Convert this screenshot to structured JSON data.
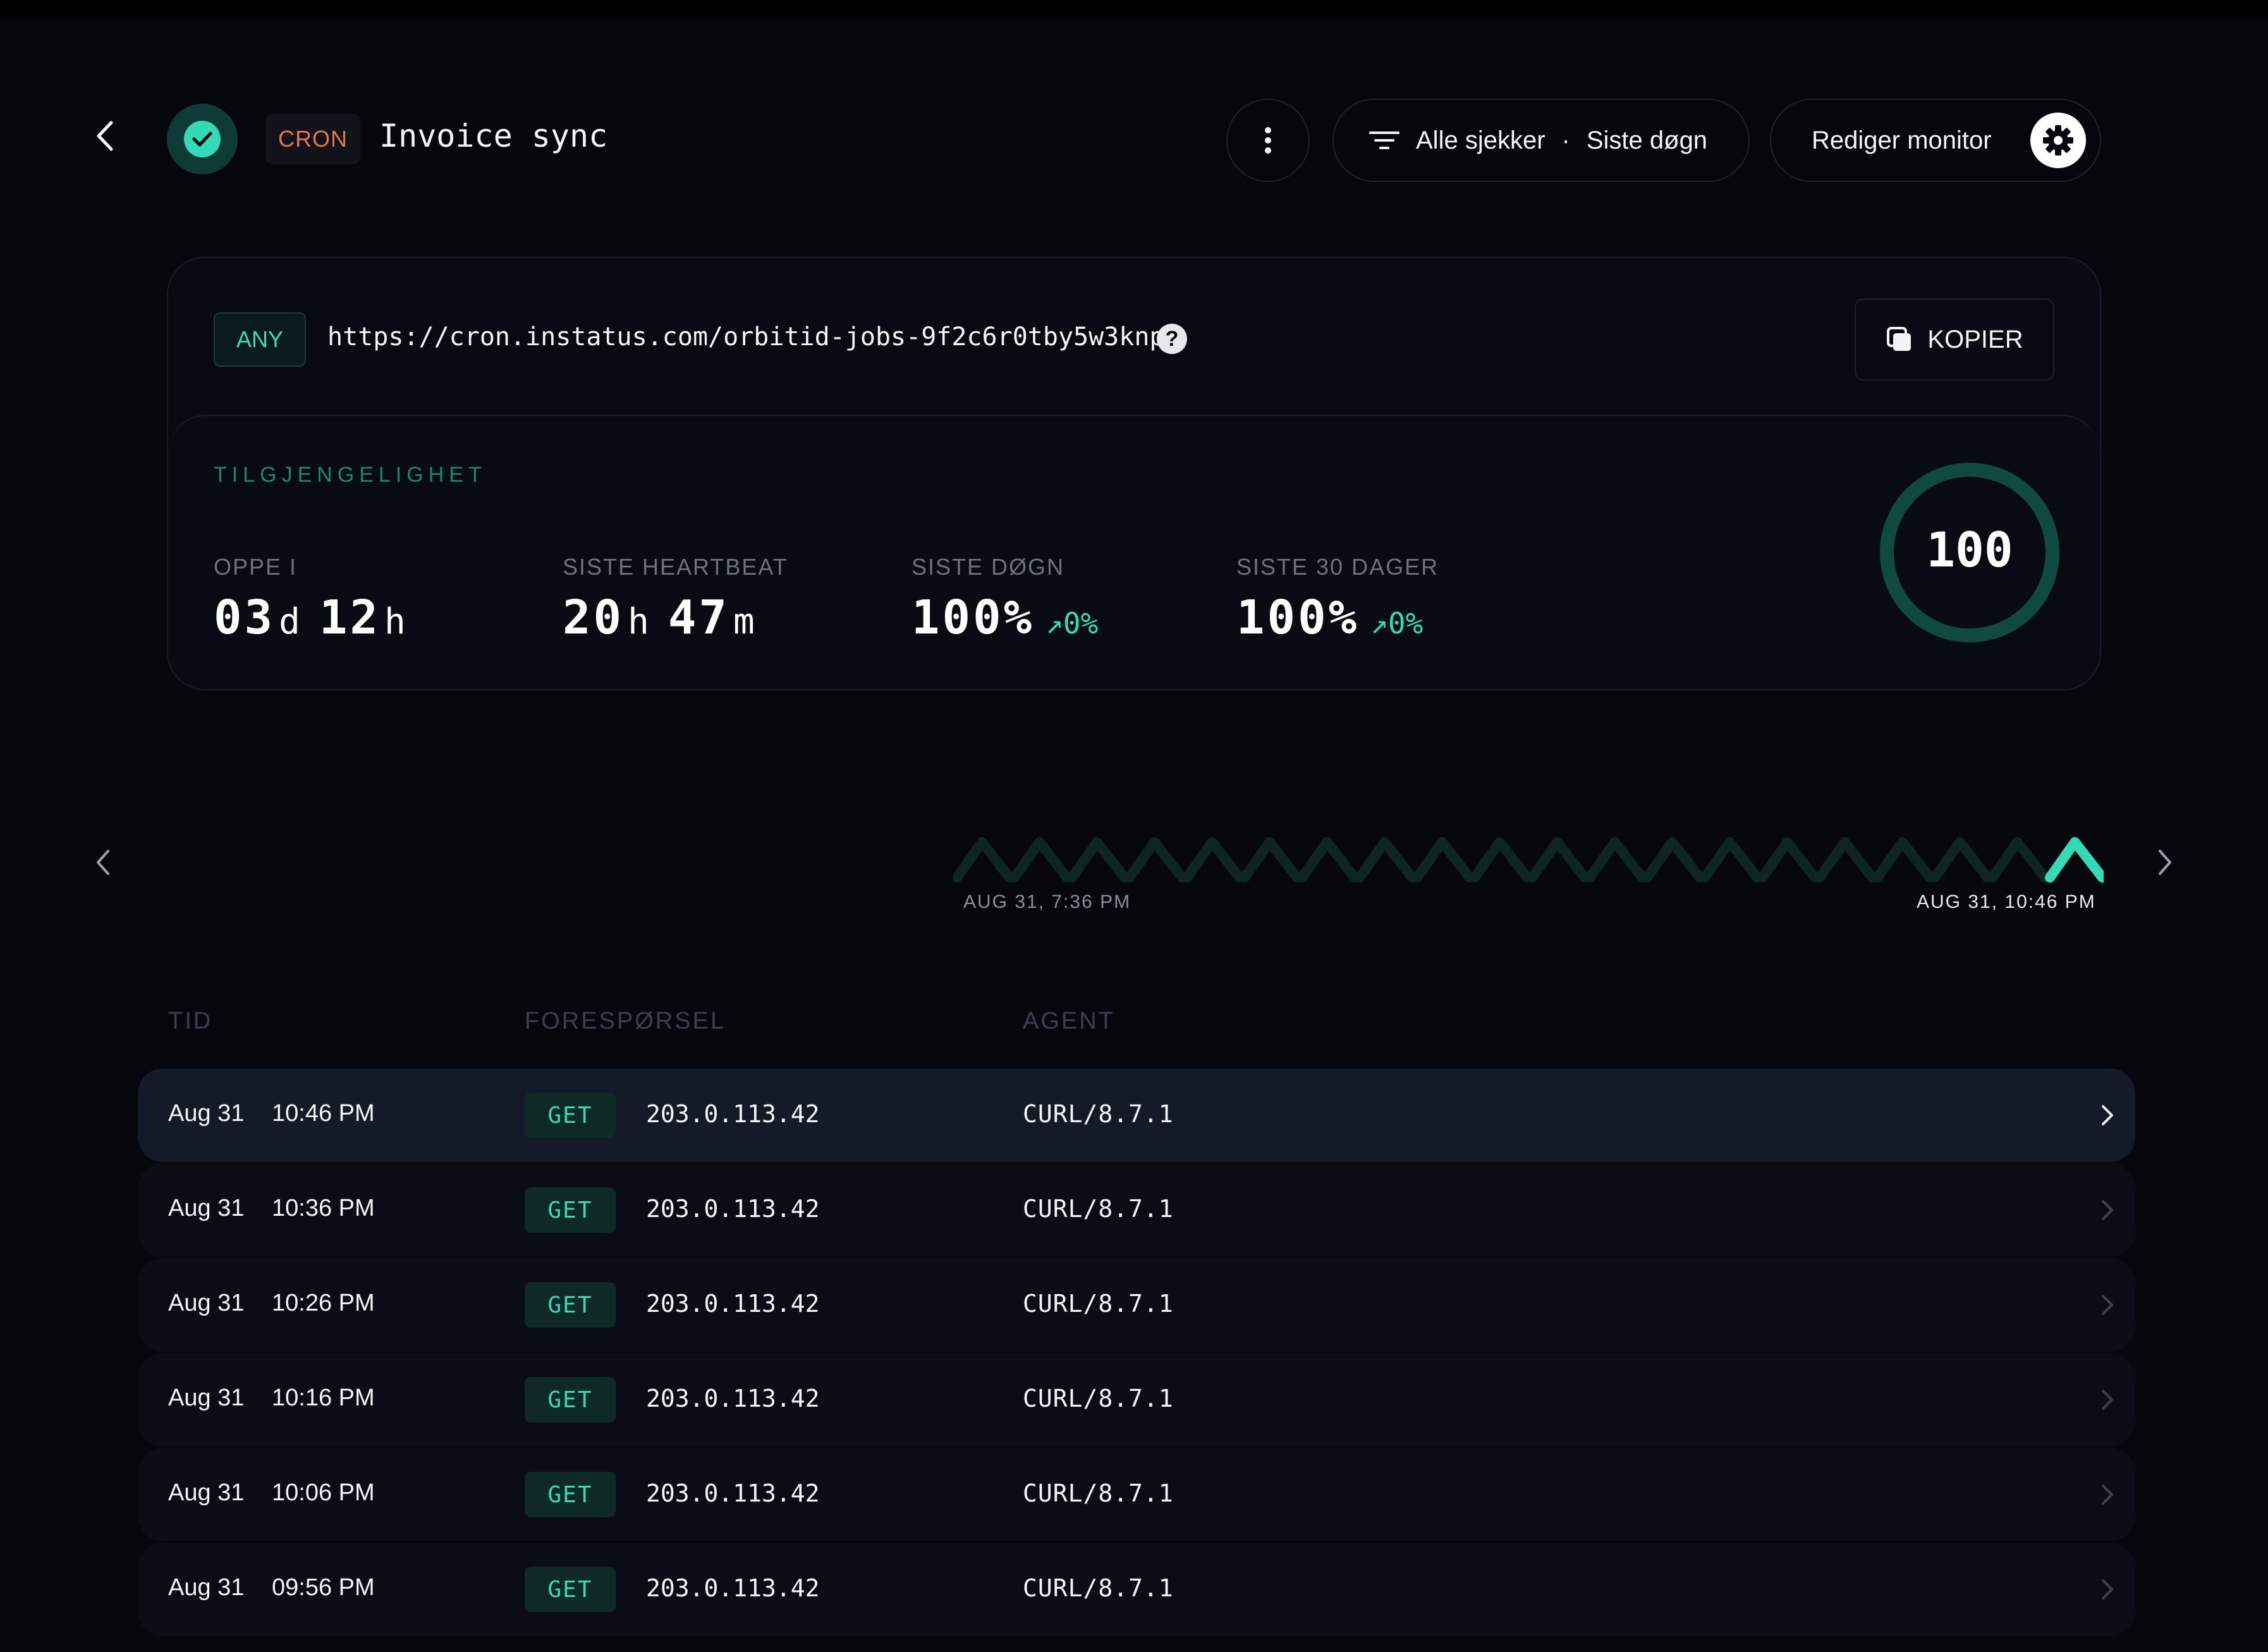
{
  "header": {
    "type_tag": "CRON",
    "title": "Invoice sync",
    "filter_label": "Alle sjekker",
    "filter_separator": "·",
    "filter_range": "Siste døgn",
    "edit_label": "Rediger monitor"
  },
  "endpoint": {
    "method_tag": "ANY",
    "url": "https://cron.instatus.com/orbitid-jobs-9f2c6r0tby5w3knp",
    "help_glyph": "?",
    "copy_label": "KOPIER"
  },
  "availability": {
    "section_label": "TILGJENGELIGHET",
    "uptime": {
      "label": "OPPE I",
      "v1": "03",
      "u1": "d",
      "v2": "12",
      "u2": "h"
    },
    "heartbeat": {
      "label": "SISTE HEARTBEAT",
      "v1": "20",
      "u1": "h",
      "v2": "47",
      "u2": "m"
    },
    "day": {
      "label": "SISTE DØGN",
      "value": "100%",
      "trend": "↗0%"
    },
    "month": {
      "label": "SISTE 30 DAGER",
      "value": "100%",
      "trend": "↗0%"
    },
    "score": "100",
    "score_fraction": 1.0
  },
  "timeline": {
    "start_label": "AUG 31, 7:36 PM",
    "end_label": "AUG 31, 10:46 PM",
    "beats": 20,
    "highlighted_index": 19
  },
  "table": {
    "headers": {
      "time": "TID",
      "request": "FORESPØRSEL",
      "agent": "AGENT"
    },
    "rows": [
      {
        "date": "Aug 31",
        "time": "10:46 PM",
        "method": "GET",
        "ip": "203.0.113.42",
        "agent": "CURL/8.7.1"
      },
      {
        "date": "Aug 31",
        "time": "10:36 PM",
        "method": "GET",
        "ip": "203.0.113.42",
        "agent": "CURL/8.7.1"
      },
      {
        "date": "Aug 31",
        "time": "10:26 PM",
        "method": "GET",
        "ip": "203.0.113.42",
        "agent": "CURL/8.7.1"
      },
      {
        "date": "Aug 31",
        "time": "10:16 PM",
        "method": "GET",
        "ip": "203.0.113.42",
        "agent": "CURL/8.7.1"
      },
      {
        "date": "Aug 31",
        "time": "10:06 PM",
        "method": "GET",
        "ip": "203.0.113.42",
        "agent": "CURL/8.7.1"
      },
      {
        "date": "Aug 31",
        "time": "09:56 PM",
        "method": "GET",
        "ip": "203.0.113.42",
        "agent": "CURL/8.7.1"
      }
    ]
  },
  "colors": {
    "accent": "#35d9b4",
    "accent_dim": "#0f3b36",
    "cron_tag": "#e8744a",
    "background": "#05070d"
  }
}
